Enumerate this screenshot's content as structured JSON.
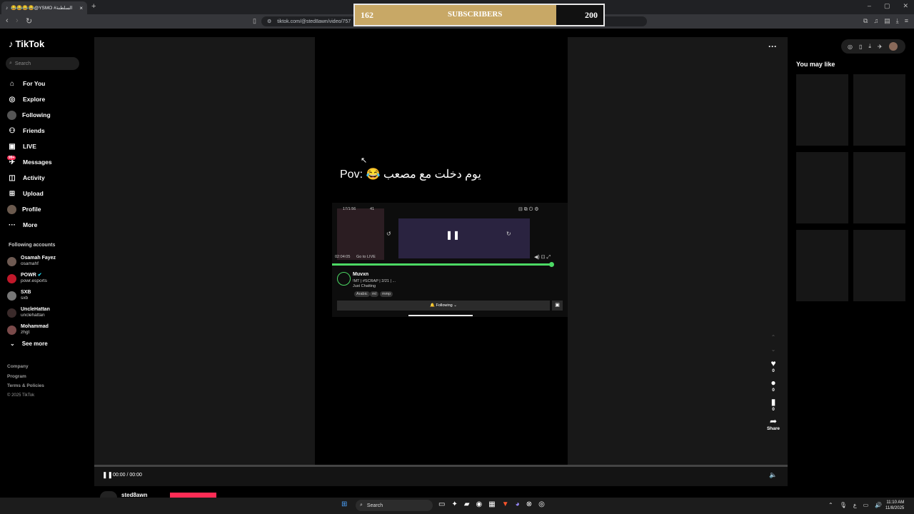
{
  "browser": {
    "tab_title": "😂😂😂😂@YSMO #السلطنة",
    "tab_close": "×",
    "new_tab": "+",
    "url": "tiktok.com/@sted8awn/video/757",
    "window_controls": [
      "–",
      "▢",
      "✕"
    ]
  },
  "overlay": {
    "current": "162",
    "label": "SUBSCRIBERS",
    "goal": "200",
    "fill_fraction": 0.81
  },
  "sidebar": {
    "logo": "TikTok",
    "search_placeholder": "Search",
    "nav": [
      {
        "label": "For You",
        "icon": "home-icon"
      },
      {
        "label": "Explore",
        "icon": "compass-icon"
      },
      {
        "label": "Following",
        "icon": "following-avatar"
      },
      {
        "label": "Friends",
        "icon": "friends-icon"
      },
      {
        "label": "LIVE",
        "icon": "live-icon"
      },
      {
        "label": "Messages",
        "icon": "messages-icon",
        "badge": "99+"
      },
      {
        "label": "Activity",
        "icon": "activity-icon"
      },
      {
        "label": "Upload",
        "icon": "upload-icon"
      },
      {
        "label": "Profile",
        "icon": "profile-avatar"
      },
      {
        "label": "More",
        "icon": "more-icon"
      }
    ],
    "following_title": "Following accounts",
    "accounts": [
      {
        "name": "Osamah Fayez",
        "handle": "osamahf"
      },
      {
        "name": "POWR",
        "handle": "powr.esports"
      },
      {
        "name": "SXB",
        "handle": "sxb"
      },
      {
        "name": "UncleHattan",
        "handle": "unclehattan"
      },
      {
        "name": "Mohammad",
        "handle": "zhgt"
      }
    ],
    "see_more": "See more",
    "footer": [
      "Company",
      "Program",
      "Terms & Policies"
    ],
    "copyright": "© 2025 TikTok"
  },
  "video": {
    "caption": "Pov: 😂 يوم دخلت مع مصعب",
    "embed_streamer": "Muvxn",
    "embed_title": "!MT | #SCRAP | 2/21 | ...",
    "embed_category": "Just Chatting",
    "embed_tags": [
      "Arabic",
      "ml",
      "mmp"
    ],
    "embed_following": "Following",
    "embed_time": "02:04:05",
    "embed_go_live": "Go to LIVE",
    "embed_viewers": "17/1:56",
    "embed_count": "41",
    "time": "00:00 / 00:00",
    "author": "sted8awn"
  },
  "actions": {
    "like_count": "0",
    "comment_count": "0",
    "save_count": "0",
    "share_label": "Share"
  },
  "right": {
    "title": "You may like"
  },
  "taskbar": {
    "search": "Search",
    "time": "11:10 AM",
    "date": "11/8/2025",
    "lang": "ع"
  }
}
